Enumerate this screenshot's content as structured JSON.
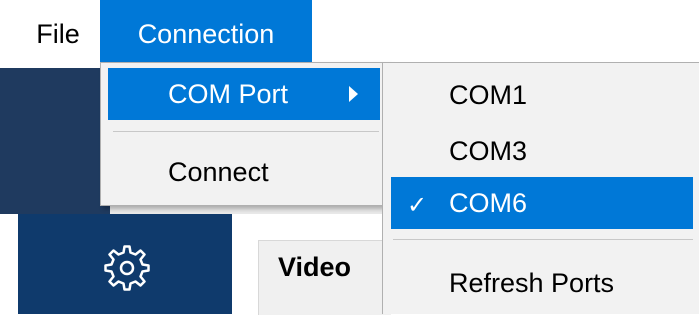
{
  "menubar": {
    "file_label": "File",
    "connection_label": "Connection"
  },
  "connection_menu": {
    "com_port_label": "COM Port",
    "connect_label": "Connect"
  },
  "com_port_submenu": {
    "items": [
      "COM1",
      "COM3",
      "COM6"
    ],
    "selected": "COM6",
    "check_glyph": "✓",
    "refresh_label": "Refresh Ports"
  },
  "app": {
    "video_label": "Video",
    "settings_icon": "gear-icon"
  },
  "colors": {
    "highlight": "#0078d7",
    "sidebar": "#0f3a6c",
    "menu_bg": "#f2f2f2"
  }
}
